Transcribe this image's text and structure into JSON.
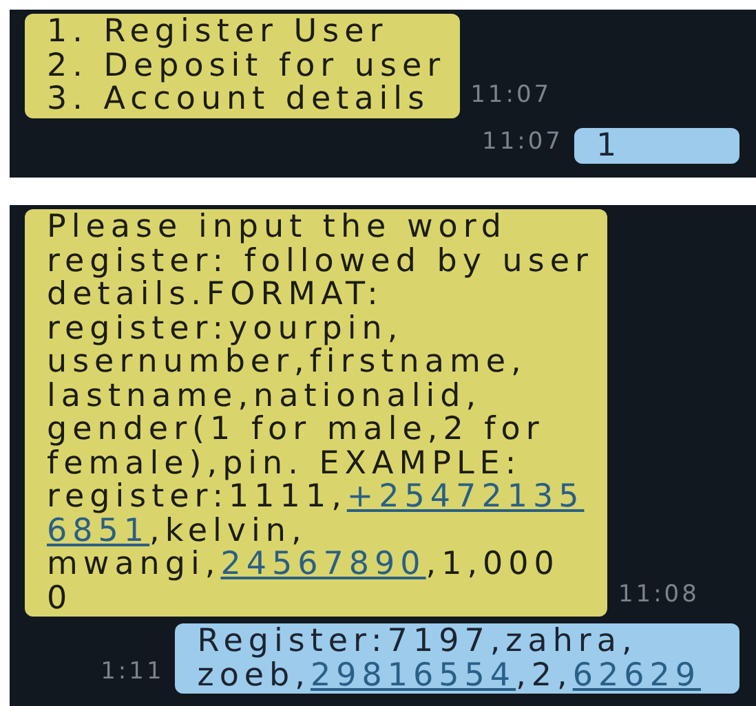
{
  "panels": [
    {
      "messages": [
        {
          "kind": "incoming",
          "time": "11:07",
          "lines": [
            [
              {
                "kind": "text",
                "text": "1. Register User"
              }
            ],
            [
              {
                "kind": "text",
                "text": "2. Deposit for user"
              }
            ],
            [
              {
                "kind": "text",
                "text": "3. Account details"
              }
            ]
          ]
        },
        {
          "kind": "outgoing",
          "time": "11:07",
          "lines": [
            [
              {
                "kind": "text",
                "text": "1"
              }
            ]
          ]
        }
      ]
    },
    {
      "messages": [
        {
          "kind": "incoming",
          "time": "11:08",
          "lines": [
            [
              {
                "kind": "text",
                "text": "Please input the word"
              }
            ],
            [
              {
                "kind": "text",
                "text": "register: followed by user"
              }
            ],
            [
              {
                "kind": "text",
                "text": "details.FORMAT:"
              }
            ],
            [
              {
                "kind": "text",
                "text": "register:yourpin,"
              }
            ],
            [
              {
                "kind": "text",
                "text": "usernumber,firstname,"
              }
            ],
            [
              {
                "kind": "text",
                "text": "lastname,nationalid,"
              }
            ],
            [
              {
                "kind": "text",
                "text": "gender(1 for male,2 for"
              }
            ],
            [
              {
                "kind": "text",
                "text": "female),pin. EXAMPLE:"
              }
            ],
            [
              {
                "kind": "text",
                "text": "register:1111,"
              },
              {
                "kind": "link",
                "text": "+25472135"
              }
            ],
            [
              {
                "kind": "link",
                "text": "6851"
              },
              {
                "kind": "text",
                "text": ",kelvin,"
              }
            ],
            [
              {
                "kind": "text",
                "text": "mwangi,"
              },
              {
                "kind": "link",
                "text": "24567890"
              },
              {
                "kind": "text",
                "text": ",1,000"
              }
            ],
            [
              {
                "kind": "text",
                "text": "0"
              }
            ]
          ]
        },
        {
          "kind": "outgoing",
          "time": "1:11",
          "lines": [
            [
              {
                "kind": "text",
                "text": "Register:7197,zahra,"
              }
            ],
            [
              {
                "kind": "text",
                "text": "zoeb,"
              },
              {
                "kind": "link",
                "text": "29816554"
              },
              {
                "kind": "text",
                "text": ",2,"
              },
              {
                "kind": "link",
                "text": "62629"
              }
            ]
          ]
        }
      ]
    }
  ]
}
